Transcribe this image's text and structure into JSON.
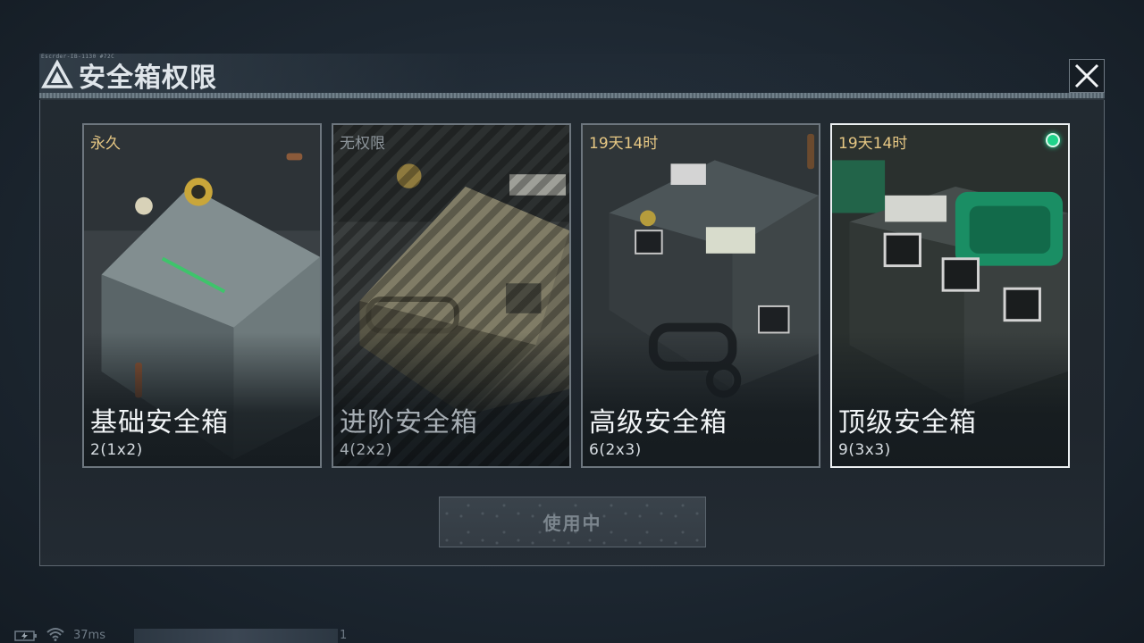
{
  "header": {
    "title": "安全箱权限",
    "code_text": "Escrder-IB-1130 #72C"
  },
  "cards": [
    {
      "status": "永久",
      "status_color": "#e7c884",
      "name": "基础安全箱",
      "capacity": "2(1x2)",
      "locked": false,
      "selected": false
    },
    {
      "status": "无权限",
      "status_color": "#8d959b",
      "name": "进阶安全箱",
      "capacity": "4(2x2)",
      "locked": true,
      "selected": false
    },
    {
      "status": "19天14时",
      "status_color": "#e7c884",
      "name": "高级安全箱",
      "capacity": "6(2x3)",
      "locked": false,
      "selected": false
    },
    {
      "status": "19天14时",
      "status_color": "#e7c884",
      "name": "顶级安全箱",
      "capacity": "9(3x3)",
      "locked": false,
      "selected": true
    }
  ],
  "use_button": {
    "label": "使用中"
  },
  "statusbar": {
    "ping": "37ms",
    "number": "1"
  },
  "colors": {
    "accent_green": "#1fd38a",
    "status_gold": "#e7c884"
  }
}
